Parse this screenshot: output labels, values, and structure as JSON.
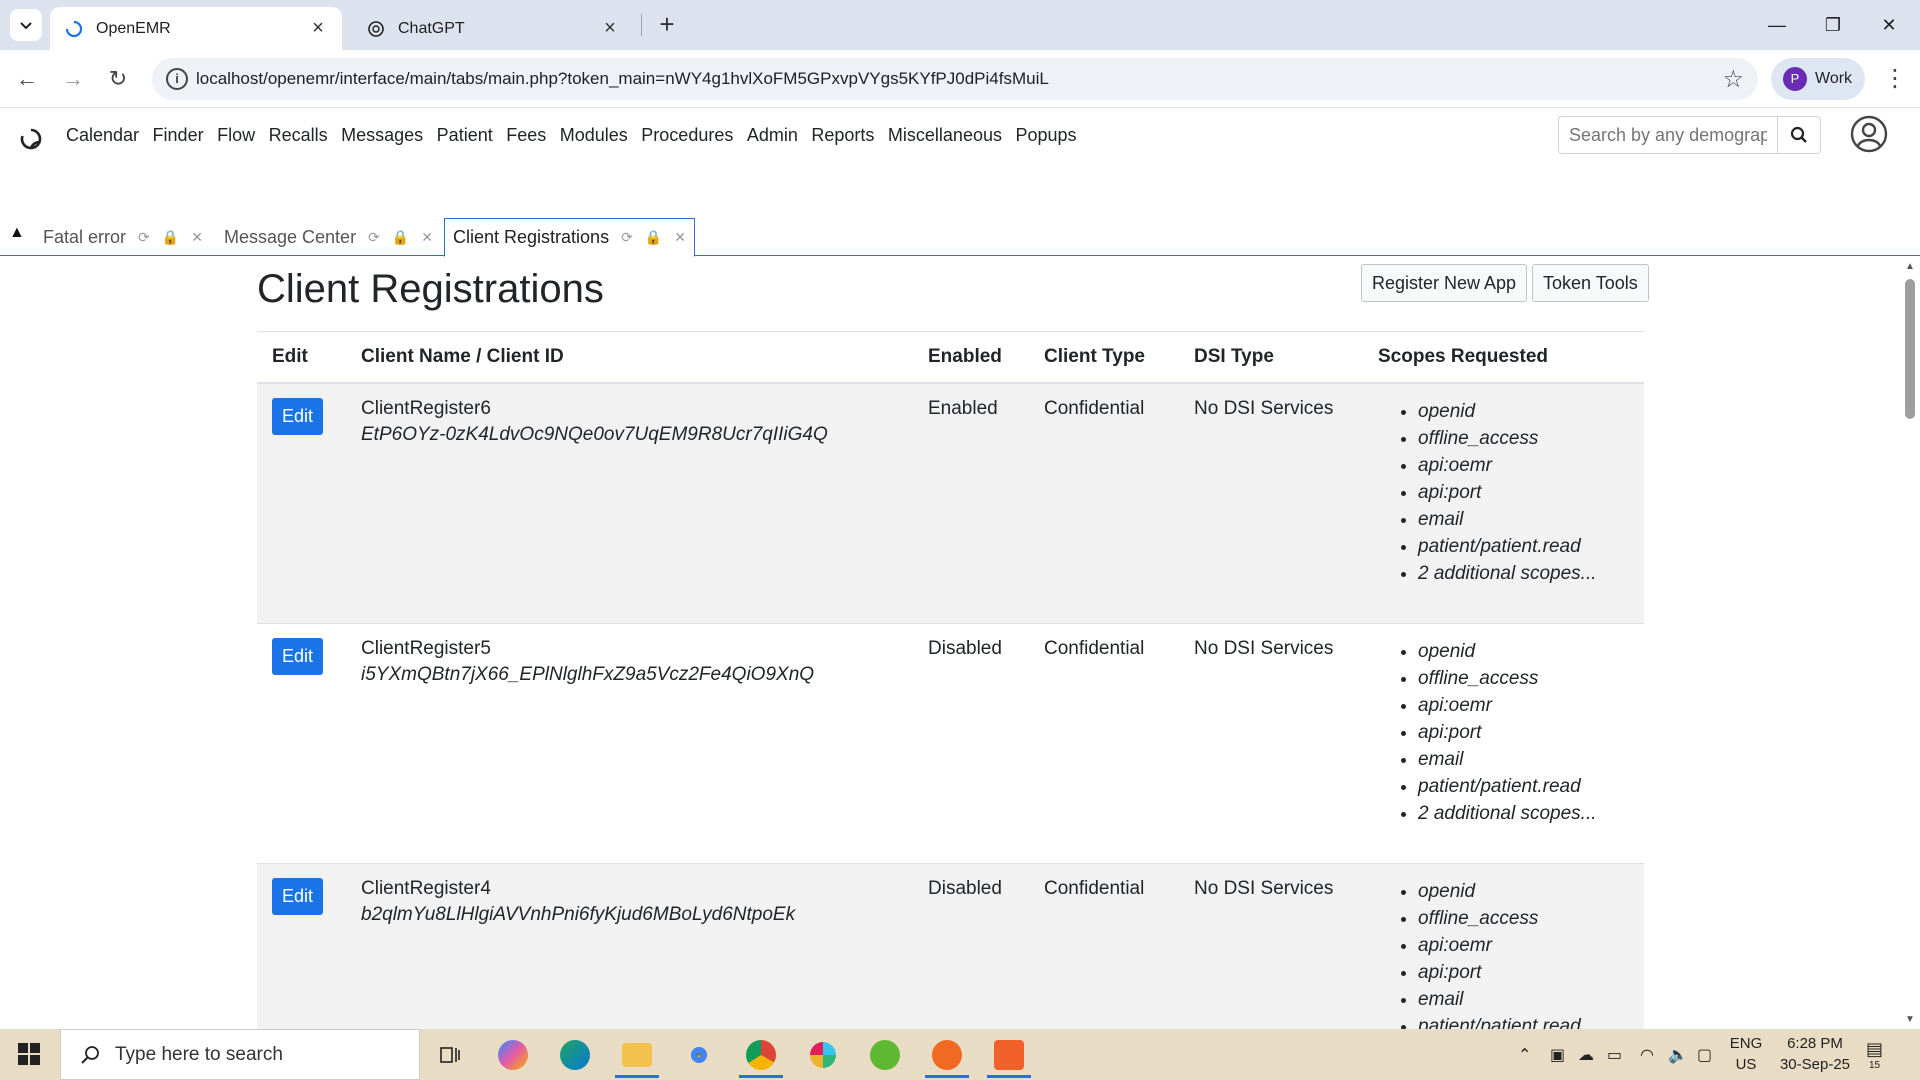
{
  "browser": {
    "tabs": [
      {
        "title": "OpenEMR",
        "active": true
      },
      {
        "title": "ChatGPT",
        "active": false
      }
    ],
    "url": "localhost/openemr/interface/main/tabs/main.php?token_main=nWY4g1hvlXoFM5GPxvpVYgs5KYfPJ0dPi4fsMuiL",
    "profile_initial": "P",
    "profile_label": "Work"
  },
  "emr_menu": [
    "Calendar",
    "Finder",
    "Flow",
    "Recalls",
    "Messages",
    "Patient",
    "Fees",
    "Modules",
    "Procedures",
    "Admin",
    "Reports",
    "Miscellaneous",
    "Popups"
  ],
  "search": {
    "placeholder": "Search by any demographics"
  },
  "emr_tabs": [
    {
      "label": "Fatal error",
      "active": false
    },
    {
      "label": "Message Center",
      "active": false
    },
    {
      "label": "Client Registrations",
      "active": true
    }
  ],
  "page": {
    "title": "Client Registrations",
    "register_btn": "Register New App",
    "token_btn": "Token Tools",
    "headers": {
      "edit": "Edit",
      "client": "Client Name / Client ID",
      "enabled": "Enabled",
      "client_type": "Client Type",
      "dsi_type": "DSI Type",
      "scopes": "Scopes Requested"
    },
    "edit_label": "Edit",
    "rows": [
      {
        "name": "ClientRegister6",
        "client_id": "EtP6OYz-0zK4LdvOc9NQe0ov7UqEM9R8Ucr7qIIiG4Q",
        "enabled": "Enabled",
        "client_type": "Confidential",
        "dsi_type": "No DSI Services",
        "scopes": [
          "openid",
          "offline_access",
          "api:oemr",
          "api:port",
          "email",
          "patient/patient.read",
          "2 additional scopes..."
        ]
      },
      {
        "name": "ClientRegister5",
        "client_id": "i5YXmQBtn7jX66_EPlNlglhFxZ9a5Vcz2Fe4QiO9XnQ",
        "enabled": "Disabled",
        "client_type": "Confidential",
        "dsi_type": "No DSI Services",
        "scopes": [
          "openid",
          "offline_access",
          "api:oemr",
          "api:port",
          "email",
          "patient/patient.read",
          "2 additional scopes..."
        ]
      },
      {
        "name": "ClientRegister4",
        "client_id": "b2qlmYu8LlHlgiAVVnhPni6fyKjud6MBoLyd6NtpoEk",
        "enabled": "Disabled",
        "client_type": "Confidential",
        "dsi_type": "No DSI Services",
        "scopes": [
          "openid",
          "offline_access",
          "api:oemr",
          "api:port",
          "email",
          "patient/patient.read"
        ]
      }
    ]
  },
  "taskbar": {
    "search_placeholder": "Type here to search",
    "lang_line1": "ENG",
    "lang_line2": "US",
    "time": "6:28 PM",
    "date": "30-Sep-25",
    "notif_count": "15"
  }
}
